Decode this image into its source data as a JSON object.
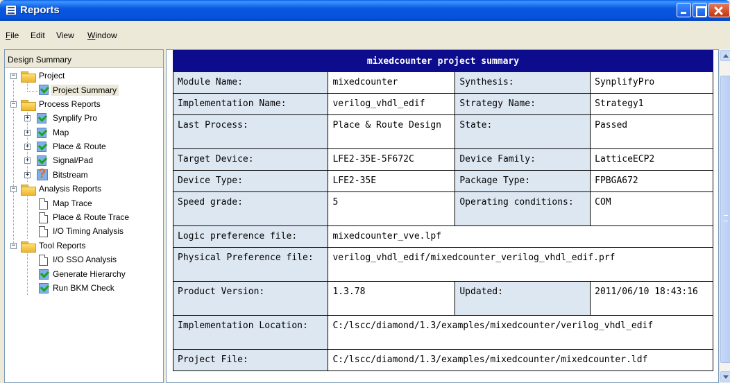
{
  "window": {
    "title": "Reports",
    "title_icon": "report-icon"
  },
  "menu": {
    "items": [
      {
        "label": "File",
        "accel": "F"
      },
      {
        "label": "Edit"
      },
      {
        "label": "View"
      },
      {
        "label": "Window",
        "accel": "W"
      }
    ]
  },
  "left_pane": {
    "header": "Design Summary",
    "tree": {
      "project": "Project",
      "project_summary": "Project Summary",
      "process_reports": "Process Reports",
      "synplify_pro": "Synplify Pro",
      "map": "Map",
      "place_route": "Place & Route",
      "signal_pad": "Signal/Pad",
      "bitstream": "Bitstream",
      "analysis_reports": "Analysis Reports",
      "map_trace": "Map Trace",
      "place_route_trace": "Place & Route Trace",
      "io_timing": "I/O Timing Analysis",
      "tool_reports": "Tool Reports",
      "io_sso": "I/O SSO Analysis",
      "generate_hierarchy": "Generate Hierarchy",
      "run_bkm": "Run BKM Check"
    }
  },
  "summary": {
    "title": "mixedcounter project summary",
    "module_name_label": "Module Name:",
    "module_name": "mixedcounter",
    "synthesis_label": "Synthesis:",
    "synthesis": "SynplifyPro",
    "impl_name_label": "Implementation Name:",
    "impl_name": "verilog_vhdl_edif",
    "strategy_label": "Strategy Name:",
    "strategy": "Strategy1",
    "last_process_label": "Last Process:",
    "last_process": "Place & Route Design",
    "state_label": "State:",
    "state": "Passed",
    "target_device_label": "Target Device:",
    "target_device": "LFE2-35E-5F672C",
    "device_family_label": "Device Family:",
    "device_family": "LatticeECP2",
    "device_type_label": "Device Type:",
    "device_type": "LFE2-35E",
    "package_type_label": "Package Type:",
    "package_type": "FPBGA672",
    "speed_grade_label": "Speed grade:",
    "speed_grade": "5",
    "operating_label": "Operating conditions:",
    "operating": "COM",
    "logic_pref_label": "Logic preference file:",
    "logic_pref": "mixedcounter_vve.lpf",
    "phys_pref_label": "Physical Preference file:",
    "phys_pref": "verilog_vhdl_edif/mixedcounter_verilog_vhdl_edif.prf",
    "product_version_label": "Product Version:",
    "product_version": "1.3.78",
    "updated_label": "Updated:",
    "updated": "2011/06/10 18:43:16",
    "impl_location_label": "Implementation Location:",
    "impl_location": "C:/lscc/diamond/1.3/examples/mixedcounter/verilog_vhdl_edif",
    "project_file_label": "Project File:",
    "project_file": "C:/lscc/diamond/1.3/examples/mixedcounter/mixedcounter.ldf"
  }
}
